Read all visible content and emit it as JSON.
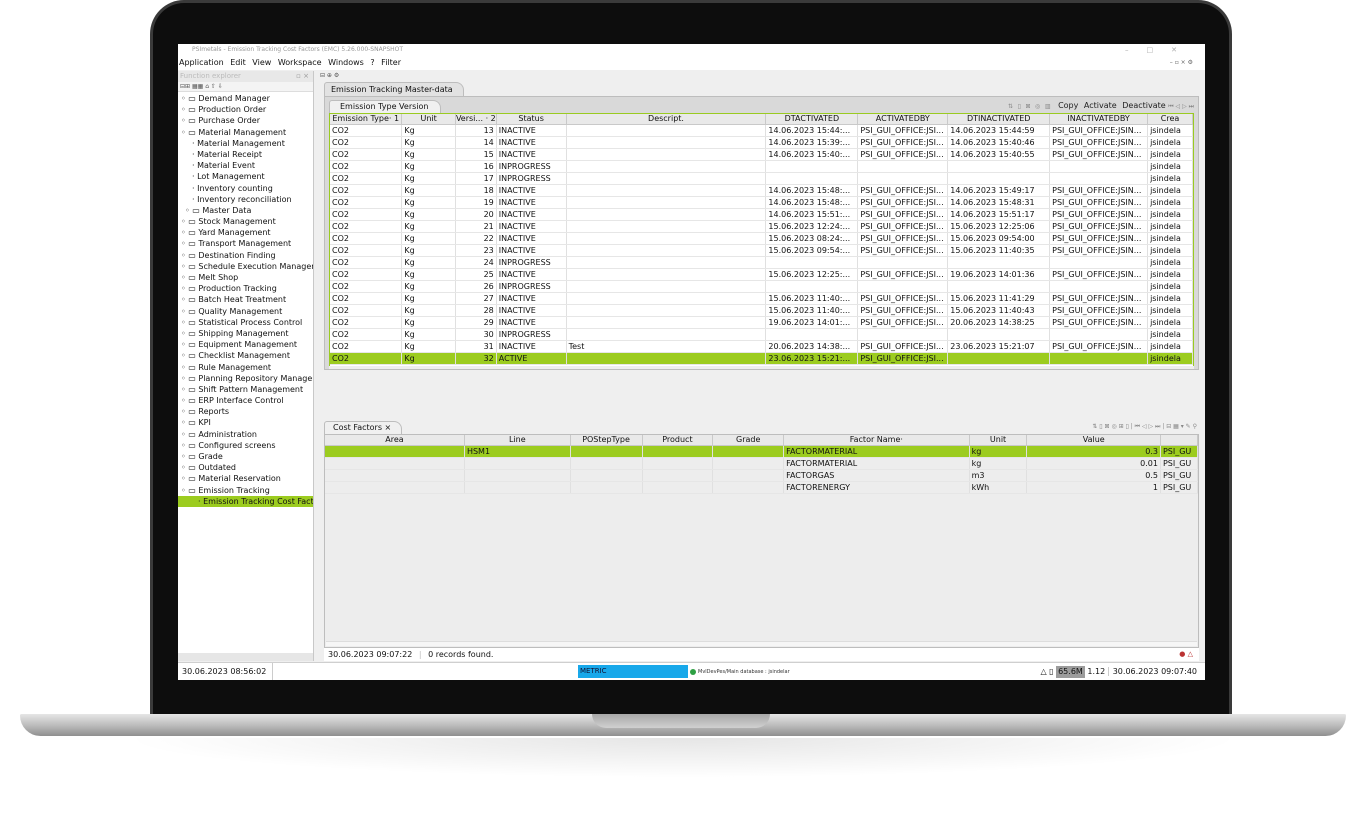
{
  "window": {
    "title": "PSImetals - Emission Tracking Cost Factors (EMC) 5.26.000-SNAPSHOT"
  },
  "menu": [
    "Application",
    "Edit",
    "View",
    "Workspace",
    "Windows",
    "?",
    "Filter"
  ],
  "explorer": {
    "title": "Function explorer",
    "items": [
      "Demand Manager",
      "Production Order",
      "Purchase Order",
      "Material Management",
      "Material Management",
      "Material Receipt",
      "Material Event",
      "Lot Management",
      "Inventory counting",
      "Inventory reconciliation",
      "Master Data",
      "Stock Management",
      "Yard Management",
      "Transport Management",
      "Destination Finding",
      "Schedule Execution Management",
      "Melt Shop",
      "Production Tracking",
      "Batch Heat Treatment",
      "Quality Management",
      "Statistical Process Control",
      "Shipping Management",
      "Equipment Management",
      "Checklist Management",
      "Rule Management",
      "Planning Repository Management",
      "Shift Pattern Management",
      "ERP Interface Control",
      "Reports",
      "KPI",
      "Administration",
      "Configured screens",
      "Grade",
      "Outdated",
      "Material Reservation",
      "Emission Tracking",
      "Emission Tracking Cost Factors"
    ]
  },
  "main_tab": "Emission Tracking Master-data",
  "sub_tab": "Emission Type Version",
  "toolbar": {
    "copy": "Copy",
    "activate": "Activate",
    "deactivate": "Deactivate"
  },
  "versions": {
    "headers": [
      "Emission Type· 1",
      "Unit",
      "Versi... · 2",
      "Status",
      "Descript.",
      "DTACTIVATED",
      "ACTIVATEDBY",
      "DTINACTIVATED",
      "INACTIVATEDBY",
      "Crea"
    ],
    "rows": [
      [
        "CO2",
        "Kg",
        "13",
        "INACTIVE",
        "",
        "14.06.2023 15:44:...",
        "PSI_GUI_OFFICE:JSI...",
        "14.06.2023 15:44:59",
        "PSI_GUI_OFFICE:JSIN...",
        "jsindela"
      ],
      [
        "CO2",
        "Kg",
        "14",
        "INACTIVE",
        "",
        "14.06.2023 15:39:...",
        "PSI_GUI_OFFICE:JSI...",
        "14.06.2023 15:40:46",
        "PSI_GUI_OFFICE:JSIN...",
        "jsindela"
      ],
      [
        "CO2",
        "Kg",
        "15",
        "INACTIVE",
        "",
        "14.06.2023 15:40:...",
        "PSI_GUI_OFFICE:JSI...",
        "14.06.2023 15:40:55",
        "PSI_GUI_OFFICE:JSIN...",
        "jsindela"
      ],
      [
        "CO2",
        "Kg",
        "16",
        "INPROGRESS",
        "",
        "",
        "",
        "",
        "",
        "jsindela"
      ],
      [
        "CO2",
        "Kg",
        "17",
        "INPROGRESS",
        "",
        "",
        "",
        "",
        "",
        "jsindela"
      ],
      [
        "CO2",
        "Kg",
        "18",
        "INACTIVE",
        "",
        "14.06.2023 15:48:...",
        "PSI_GUI_OFFICE:JSI...",
        "14.06.2023 15:49:17",
        "PSI_GUI_OFFICE:JSIN...",
        "jsindela"
      ],
      [
        "CO2",
        "Kg",
        "19",
        "INACTIVE",
        "",
        "14.06.2023 15:48:...",
        "PSI_GUI_OFFICE:JSI...",
        "14.06.2023 15:48:31",
        "PSI_GUI_OFFICE:JSIN...",
        "jsindela"
      ],
      [
        "CO2",
        "Kg",
        "20",
        "INACTIVE",
        "",
        "14.06.2023 15:51:...",
        "PSI_GUI_OFFICE:JSI...",
        "14.06.2023 15:51:17",
        "PSI_GUI_OFFICE:JSIN...",
        "jsindela"
      ],
      [
        "CO2",
        "Kg",
        "21",
        "INACTIVE",
        "",
        "15.06.2023 12:24:...",
        "PSI_GUI_OFFICE:JSI...",
        "15.06.2023 12:25:06",
        "PSI_GUI_OFFICE:JSIN...",
        "jsindela"
      ],
      [
        "CO2",
        "Kg",
        "22",
        "INACTIVE",
        "",
        "15.06.2023 08:24:...",
        "PSI_GUI_OFFICE:JSI...",
        "15.06.2023 09:54:00",
        "PSI_GUI_OFFICE:JSIN...",
        "jsindela"
      ],
      [
        "CO2",
        "Kg",
        "23",
        "INACTIVE",
        "",
        "15.06.2023 09:54:...",
        "PSI_GUI_OFFICE:JSI...",
        "15.06.2023 11:40:35",
        "PSI_GUI_OFFICE:JSIN...",
        "jsindela"
      ],
      [
        "CO2",
        "Kg",
        "24",
        "INPROGRESS",
        "",
        "",
        "",
        "",
        "",
        "jsindela"
      ],
      [
        "CO2",
        "Kg",
        "25",
        "INACTIVE",
        "",
        "15.06.2023 12:25:...",
        "PSI_GUI_OFFICE:JSI...",
        "19.06.2023 14:01:36",
        "PSI_GUI_OFFICE:JSIN...",
        "jsindela"
      ],
      [
        "CO2",
        "Kg",
        "26",
        "INPROGRESS",
        "",
        "",
        "",
        "",
        "",
        "jsindela"
      ],
      [
        "CO2",
        "Kg",
        "27",
        "INACTIVE",
        "",
        "15.06.2023 11:40:...",
        "PSI_GUI_OFFICE:JSI...",
        "15.06.2023 11:41:29",
        "PSI_GUI_OFFICE:JSIN...",
        "jsindela"
      ],
      [
        "CO2",
        "Kg",
        "28",
        "INACTIVE",
        "",
        "15.06.2023 11:40:...",
        "PSI_GUI_OFFICE:JSI...",
        "15.06.2023 11:40:43",
        "PSI_GUI_OFFICE:JSIN...",
        "jsindela"
      ],
      [
        "CO2",
        "Kg",
        "29",
        "INACTIVE",
        "",
        "19.06.2023 14:01:...",
        "PSI_GUI_OFFICE:JSI...",
        "20.06.2023 14:38:25",
        "PSI_GUI_OFFICE:JSIN...",
        "jsindela"
      ],
      [
        "CO2",
        "Kg",
        "30",
        "INPROGRESS",
        "",
        "",
        "",
        "",
        "",
        "jsindela"
      ],
      [
        "CO2",
        "Kg",
        "31",
        "INACTIVE",
        "Test",
        "20.06.2023 14:38:...",
        "PSI_GUI_OFFICE:JSI...",
        "23.06.2023 15:21:07",
        "PSI_GUI_OFFICE:JSIN...",
        "jsindela"
      ],
      [
        "CO2",
        "Kg",
        "32",
        "ACTIVE",
        "",
        "23.06.2023 15:21:...",
        "PSI_GUI_OFFICE:JSI...",
        "",
        "",
        "jsindela"
      ]
    ]
  },
  "cost_tab": "Cost Factors",
  "cost": {
    "headers": [
      "Area",
      "Line",
      "POStepType",
      "Product",
      "Grade",
      "Factor Name·",
      "Unit",
      "Value",
      ""
    ],
    "rows": [
      [
        "",
        "HSM1",
        "",
        "",
        "",
        "FACTORMATERIAL",
        "kg",
        "0.3",
        "PSI_GU"
      ],
      [
        "",
        "",
        "",
        "",
        "",
        "FACTORMATERIAL",
        "kg",
        "0.01",
        "PSI_GU"
      ],
      [
        "",
        "",
        "",
        "",
        "",
        "FACTORGAS",
        "m3",
        "0.5",
        "PSI_GU"
      ],
      [
        "",
        "",
        "",
        "",
        "",
        "FACTORENERGY",
        "kWh",
        "1",
        "PSI_GU"
      ]
    ]
  },
  "status": {
    "time": "30.06.2023 09:07:22",
    "message": "0 records found."
  },
  "bottom": {
    "left_time": "30.06.2023 08:56:02",
    "metric": "METRIC",
    "db": "MvlDevPes/Main database : jsindelar",
    "mem_used": "65.6M",
    "mem_total": "1.12",
    "right_time": "30.06.2023 09:07:40"
  },
  "colors": {
    "selection": "#9ccc1f",
    "metric": "#18a8ea"
  }
}
